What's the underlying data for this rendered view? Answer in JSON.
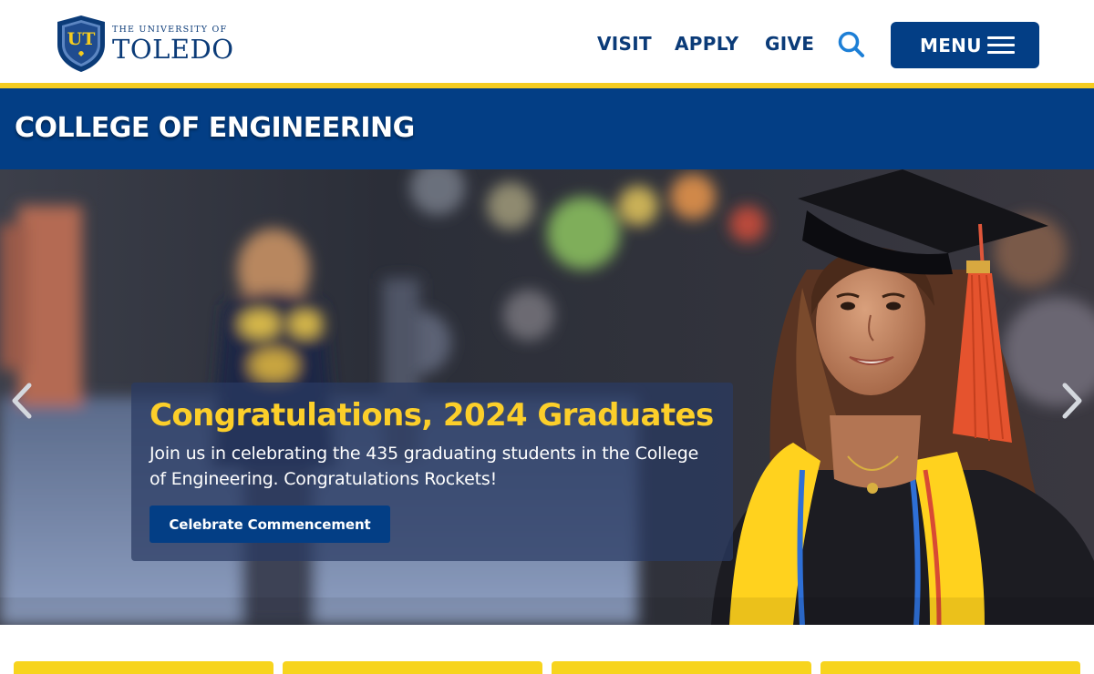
{
  "header": {
    "logo": {
      "small_text": "THE UNIVERSITY OF",
      "big_text": "TOLEDO",
      "monogram": "UT"
    },
    "nav": [
      {
        "label": "VISIT"
      },
      {
        "label": "APPLY"
      },
      {
        "label": "GIVE"
      }
    ],
    "search_icon": "search-icon",
    "menu_label": "MENU",
    "menu_icon": "hamburger-icon"
  },
  "college": {
    "title": "COLLEGE OF ENGINEERING"
  },
  "hero": {
    "title": "Congratulations, 2024 Graduates",
    "text": "Join us in celebrating the 435 graduating students in the College of Engineering. Congratulations Rockets!",
    "button_label": "Celebrate Commencement",
    "prev_icon": "chevron-left-icon",
    "next_icon": "chevron-right-icon"
  },
  "colors": {
    "brand_blue": "#033e85",
    "gold": "#f5cc1f",
    "caption_title": "#fccf2a"
  }
}
